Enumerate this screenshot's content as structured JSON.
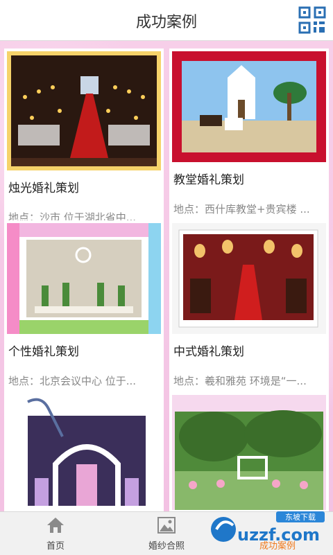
{
  "header": {
    "title": "成功案例",
    "qr_icon": "qr-code-icon"
  },
  "cards": [
    {
      "name": "烛光婚礼策划",
      "desc": "地点：沙市   位于湖北省中..."
    },
    {
      "name": "教堂婚礼策划",
      "desc": "地点：西什库教堂+贵宾楼  ..."
    },
    {
      "name": "个性婚礼策划",
      "desc": "地点：北京会议中心  位于..."
    },
    {
      "name": "中式婚礼策划",
      "desc": "地点：羲和雅苑  环境是“一..."
    }
  ],
  "tabs": [
    {
      "label": "首页",
      "icon": "home-icon"
    },
    {
      "label": "婚纱合照",
      "icon": "image-icon"
    },
    {
      "label": "成功案例",
      "icon": "trophy-icon"
    }
  ],
  "watermark": {
    "text": "uzzf.com",
    "badge": "东坡下载"
  },
  "colors": {
    "accent": "#f07a1e",
    "background": "#f4c6e6",
    "tabbar": "#f1f1f1"
  }
}
